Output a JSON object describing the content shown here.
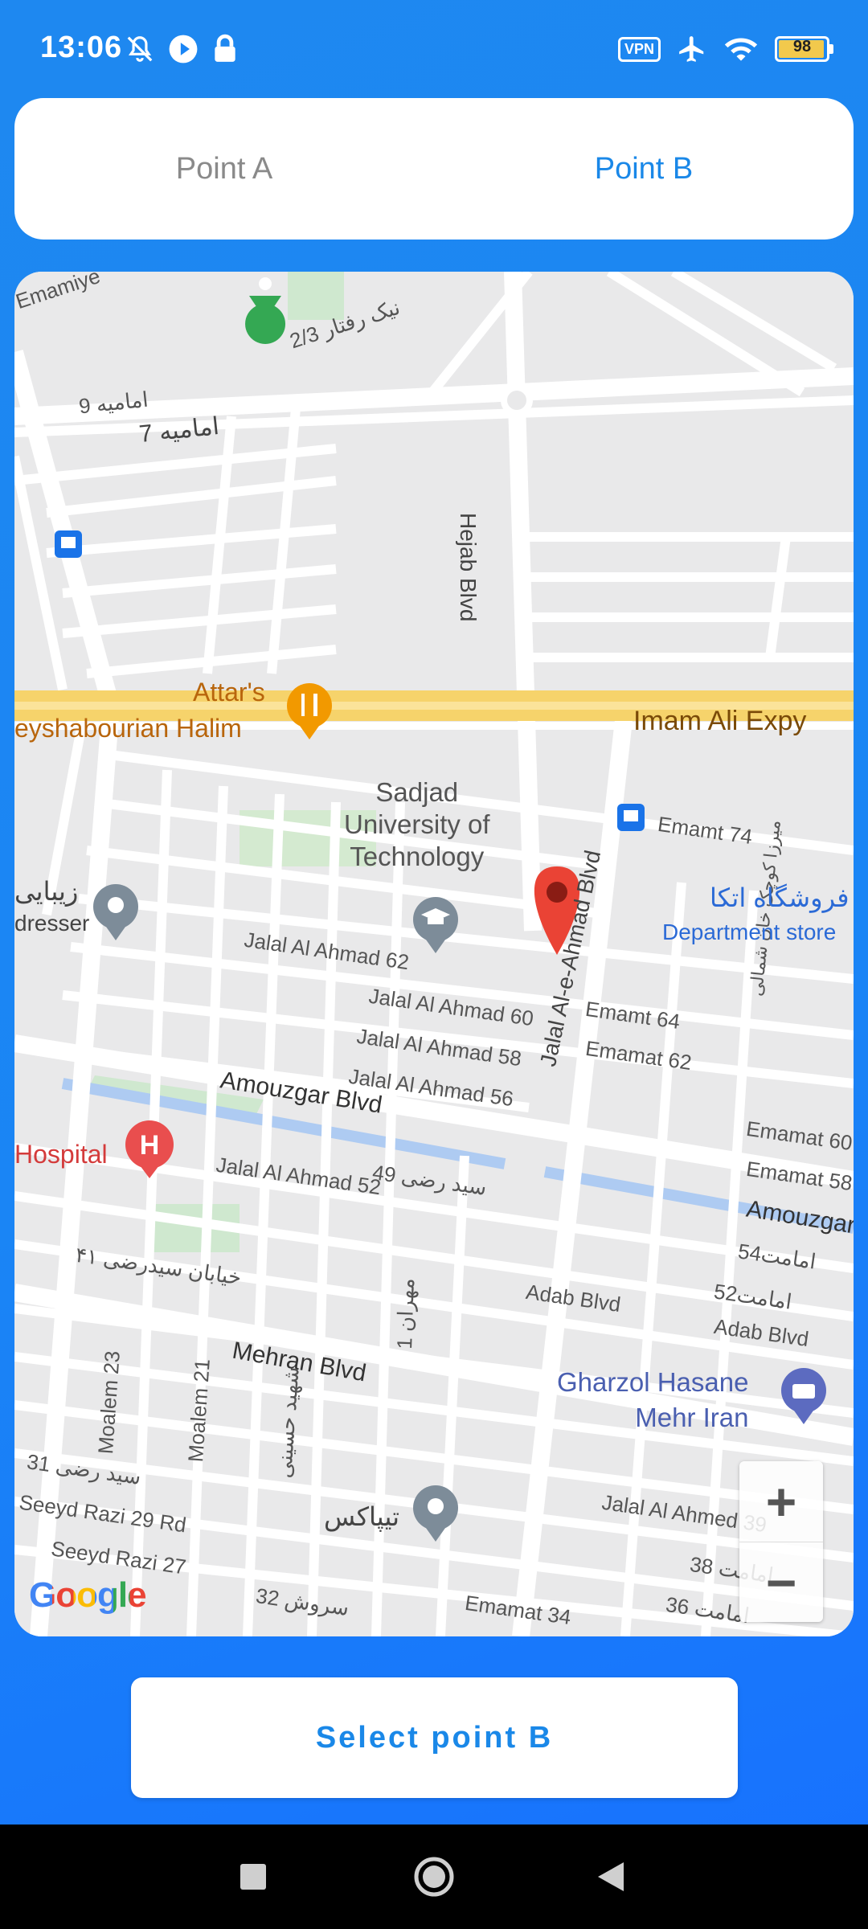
{
  "status_bar": {
    "time": "13:06",
    "vpn": "VPN",
    "battery": "98",
    "icons": [
      "bell-off-icon",
      "play-icon",
      "lock-icon",
      "airplane-icon",
      "wifi-icon",
      "battery-icon"
    ]
  },
  "tabs": [
    {
      "label": "Point A",
      "active": false
    },
    {
      "label": "Point B",
      "active": true
    }
  ],
  "map": {
    "streets": {
      "emamiye": "Emamiye",
      "nik_raftar": "2/3 نیک رفتار",
      "emamiye9": "امامیه 9",
      "emamiye7": "امامیه 7",
      "hejab": "Hejab Blvd",
      "imam_ali": "Imam Ali Expy",
      "emamt74": "Emamt 74",
      "jalal_blvd": "Jalal Al-e-Ahmad Blvd",
      "jalal62": "Jalal Al Ahmad 62",
      "jalal60": "Jalal Al Ahmad 60",
      "jalal58": "Jalal Al Ahmad 58",
      "jalal56": "Jalal Al Ahmad 56",
      "jalal52": "Jalal Al Ahmad 52",
      "jalal39": "Jalal Al Ahmed 39",
      "emamt64": "Emamt 64",
      "emamat62": "Emamat 62",
      "emamat60": "Emamat 60",
      "emamat58": "Emamat 58",
      "emamat34": "Emamat 34",
      "amouzgar": "Amouzgar Blvd",
      "amouzgar2": "Amouzgar",
      "seyed_razi49": "سید رضی 49",
      "seyed_razi31": "سید رضی 31",
      "emamat54": "امامت54",
      "emamat52": "امامت52",
      "emamat38": "امامت 38",
      "emamat36": "امامت 36",
      "seyedrazi41": "خیابان سیدرضی ۴۱",
      "adab": "Adab Blvd",
      "adab2": "Adab Blvd",
      "mehran1": "مهران 1",
      "mehran": "Mehran Blvd",
      "moalem23": "Moalem 23",
      "moalem21": "Moalem 21",
      "shahid": "شهید حسینی",
      "razi29": "Seeyd Razi 29 Rd",
      "razi27": "Seeyd Razi 27",
      "soroush32": "سروش 32",
      "mirza": "میرزا کوچک خان شمالی"
    },
    "pois": {
      "attars": "Attar's",
      "halim": "eyshabourian Halim",
      "sadjad": "Sadjad\nUniversity of\nTechnology",
      "zibaei": "زیبایی",
      "dresser": "dresser",
      "etka": "فروشگاه اتکا",
      "dept": "Department store",
      "hospital": "Hospital",
      "gharzol": "Gharzol Hasane\nMehr Iran",
      "tipax": "تیپاکس"
    },
    "zoom_in": "+",
    "zoom_out": "−",
    "attribution": "Google",
    "marker_color": "#ea4335"
  },
  "select_button": {
    "label": "Select point B"
  },
  "colors": {
    "accent": "#1a88e8",
    "background": "#1a85f5"
  }
}
